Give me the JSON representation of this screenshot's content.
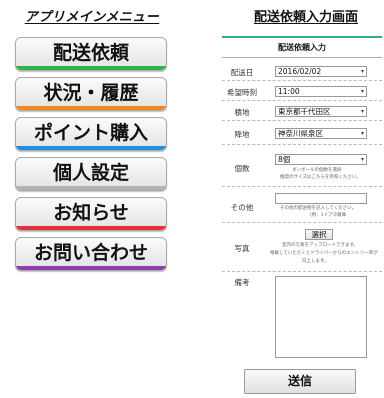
{
  "app_menu": {
    "title": "アプリメインメニュー",
    "items": [
      {
        "label": "配送依頼",
        "color": "#2db34a"
      },
      {
        "label": "状況・履歴",
        "color": "#ef8a1c"
      },
      {
        "label": "ポイント購入",
        "color": "#1f8fe0"
      },
      {
        "label": "個人設定",
        "color": "#b3b3b3"
      },
      {
        "label": "お知らせ",
        "color": "#e2323a"
      },
      {
        "label": "お問い合わせ",
        "color": "#8e3db5"
      }
    ]
  },
  "delivery_form": {
    "page_title": "配送依頼入力画面",
    "header": "配送依頼入力",
    "rows": {
      "date": {
        "label": "配送日",
        "value": "2016/02/02"
      },
      "time": {
        "label": "希望時刻",
        "value": "11:00"
      },
      "origin": {
        "label": "積地",
        "value": "東京都千代田区"
      },
      "destination": {
        "label": "降地",
        "value": "神奈川県泉区"
      },
      "count": {
        "label": "個数",
        "value": "8個",
        "note1": "ダンボールの個数を選択",
        "note2": "推奨のサイズはこちらを参照ください。"
      },
      "other": {
        "label": "その他",
        "value": "",
        "note1": "その他の配送物を記入してください。",
        "note2": "(例：1ドア冷蔵庫"
      },
      "photo": {
        "label": "写真",
        "button": "選択",
        "note1": "室内の写真をアップロードできます。",
        "note2": "根載していただくとドライバーからのエントリー率が",
        "note3": "向上します。"
      },
      "remarks": {
        "label": "備考",
        "value": ""
      }
    },
    "submit": "送信"
  },
  "colors": {
    "form_header_accent": "#2fb07a"
  }
}
